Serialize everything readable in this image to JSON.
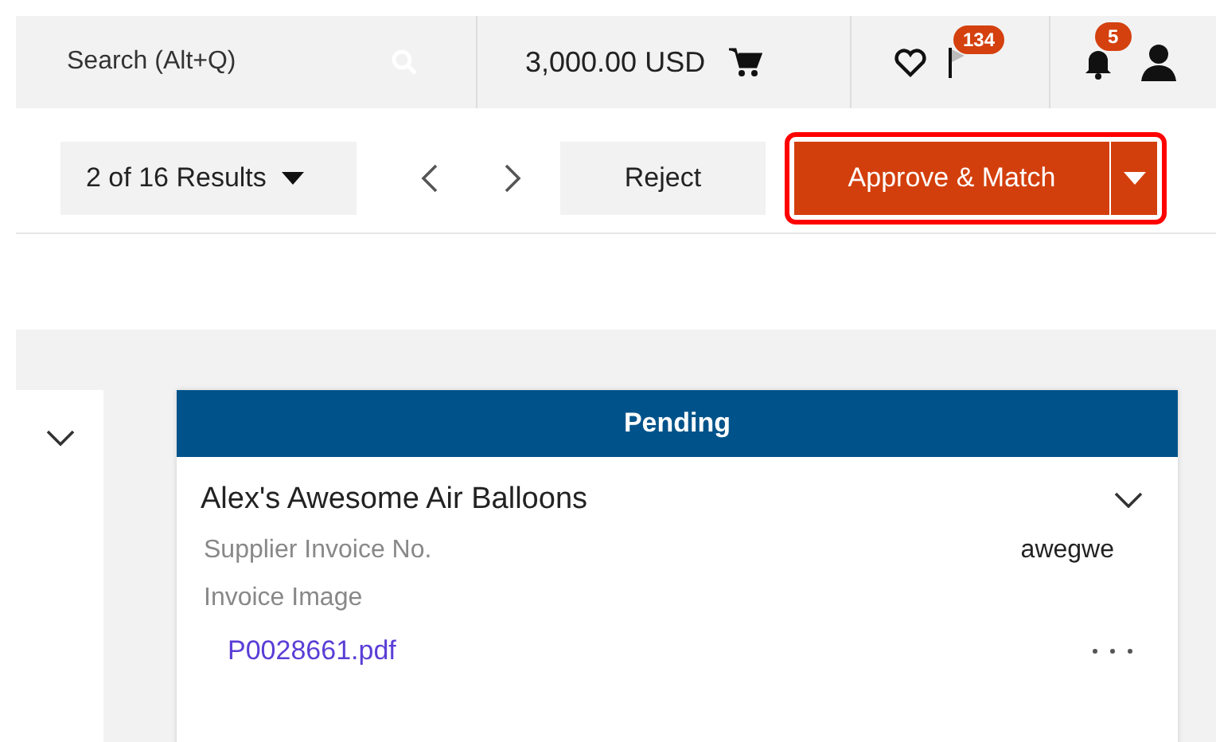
{
  "header": {
    "search": {
      "placeholder": "Search (Alt+Q)"
    },
    "cart_total": "3,000.00 USD",
    "flag_badge": "134",
    "notification_badge": "5"
  },
  "toolbar": {
    "results": "2 of 16 Results",
    "reject": "Reject",
    "approve": {
      "label": "Approve & Match",
      "highlighted": true
    }
  },
  "card": {
    "status": "Pending",
    "supplier": "Alex's Awesome Air Balloons",
    "fields": [
      {
        "label": "Supplier Invoice No.",
        "value": "awegwe"
      },
      {
        "label": "Invoice Image"
      }
    ],
    "attachment": "P0028661.pdf"
  }
}
